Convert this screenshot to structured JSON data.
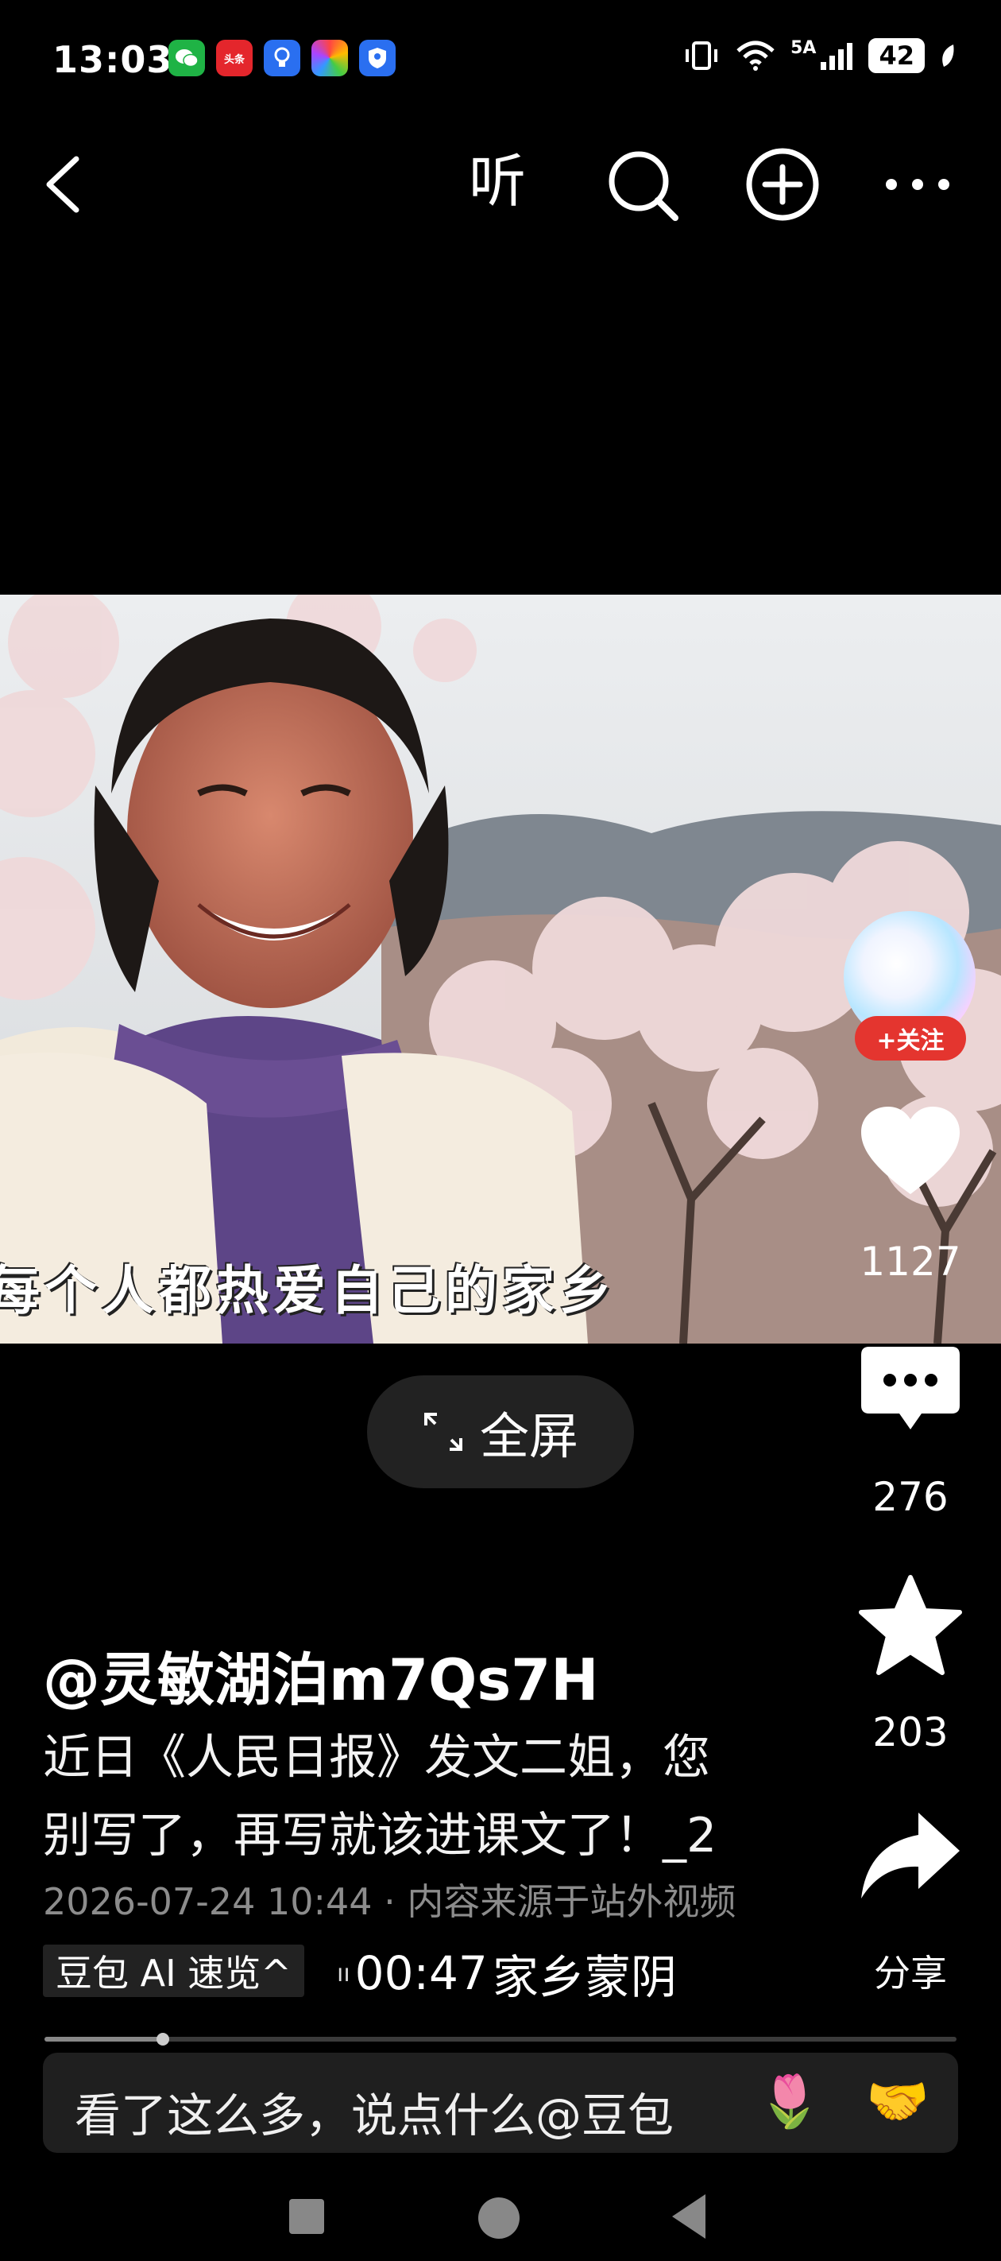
{
  "status_bar": {
    "time": "13:03",
    "app_icons": [
      "wechat-icon",
      "toutiao-icon",
      "bulb-icon",
      "photos-icon",
      "shield-icon"
    ],
    "toutiao_text": "头条",
    "network": "5A",
    "battery": "42"
  },
  "nav": {
    "listen_label": "听"
  },
  "video": {
    "subtitle": "每个人都热爱自己的家乡"
  },
  "fullscreen": {
    "label": "全屏"
  },
  "rail": {
    "follow_label": "+关注",
    "likes": "1127",
    "comments": "276",
    "favorites": "203",
    "share_label": "分享"
  },
  "post": {
    "author": "@灵敏湖泊m7Qs7H",
    "title_line1": "近日《人民日报》发文二姐，您",
    "title_line2": "别写了，再写就该进课文了！_2",
    "meta": "2026-07-24 10:44 · 内容来源于站外视频",
    "ai_chip": "豆包 AI 速览^",
    "duration": "00:47",
    "audio_title": "家乡蒙阴",
    "progress": 0.13
  },
  "comment_bar": {
    "placeholder": "看了这么多，说点什么@豆包",
    "emoji_rose": "🌷",
    "emoji_hands": "🤝"
  },
  "colors": {
    "follow_red": "#e4352f",
    "background": "#000000"
  }
}
